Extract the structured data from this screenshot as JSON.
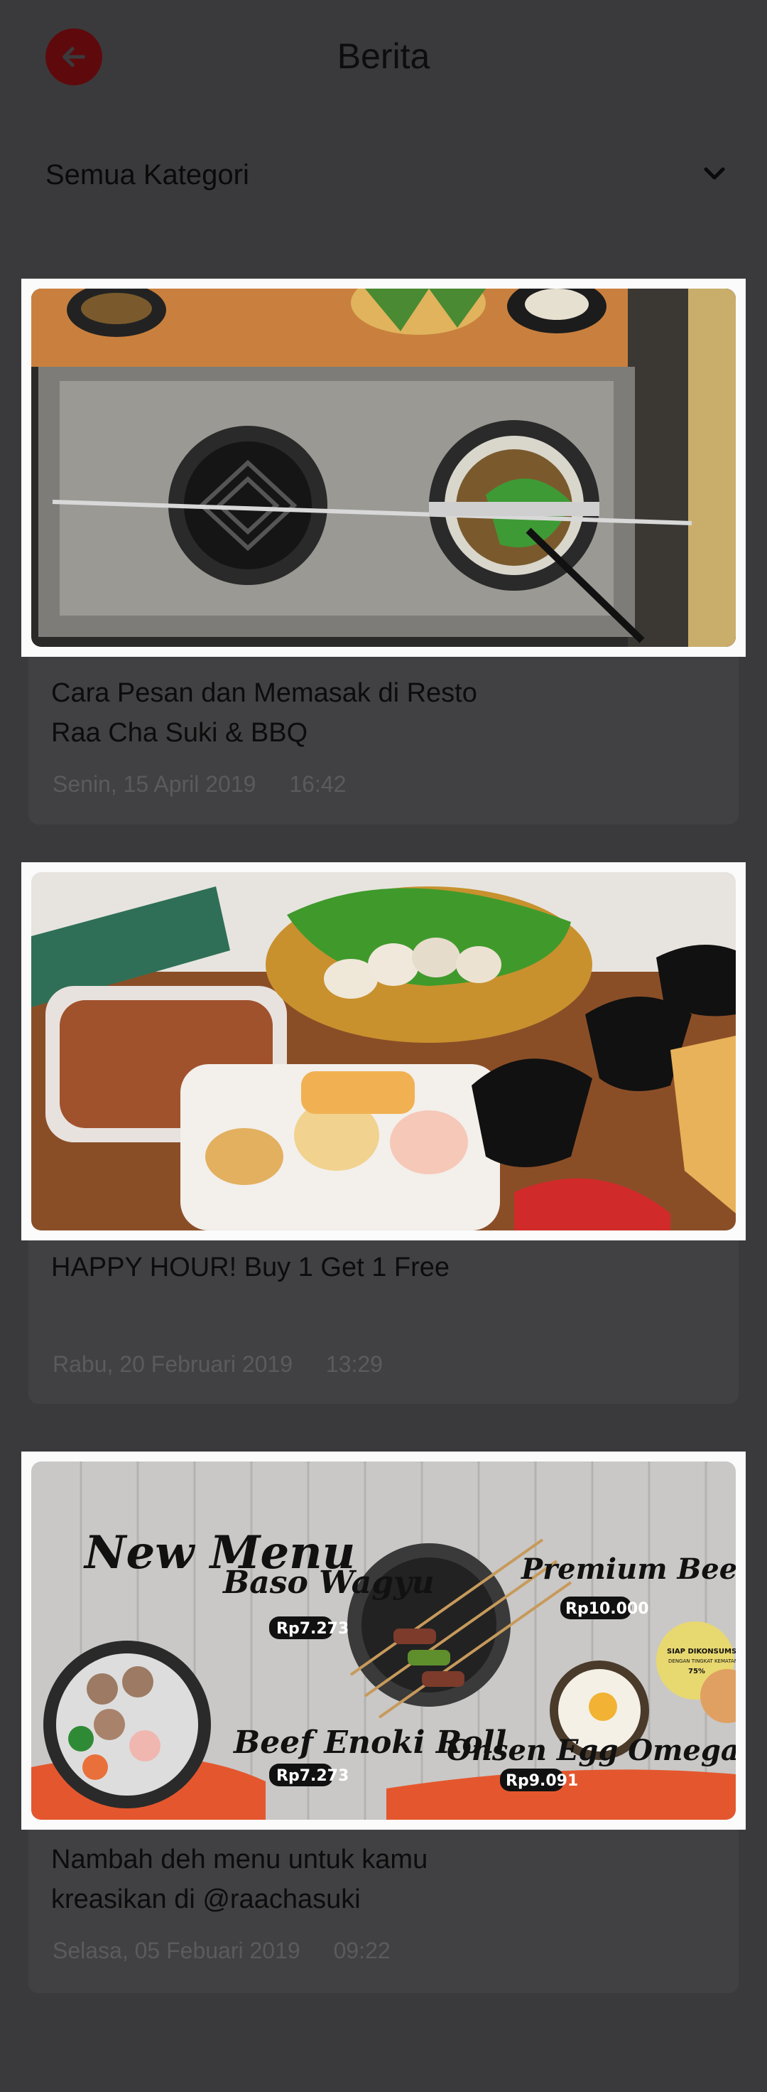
{
  "header": {
    "title": "Berita",
    "back_icon": "arrow-left-icon",
    "accent": "#5e0a0d"
  },
  "filter": {
    "label": "Semua Kategori",
    "icon": "chevron-down-icon"
  },
  "news": [
    {
      "title": "Cara Pesan dan Memasak di Resto Raa Cha Suki & BBQ",
      "date": "Senin, 15 April 2019",
      "time": "16:42"
    },
    {
      "title": "HAPPY HOUR! Buy 1 Get 1 Free",
      "date": "Rabu, 20 Februari 2019",
      "time": "13:29"
    },
    {
      "title": "Nambah deh menu untuk kamu kreasikan di @raachasuki",
      "date": "Selasa, 05 Febuari 2019",
      "time": "09:22",
      "poster": {
        "new_menu": "New Menu",
        "item1_name": "Baso Wagyu",
        "item1_price": "Rp7.273",
        "item2_name": "Beef Enoki Roll",
        "item2_price": "Rp7.273",
        "item3_name": "Premium Beef Satay",
        "item3_price": "Rp10.000",
        "item4_name": "Onsen Egg Omega",
        "item4_price": "Rp9.091",
        "badge_line1": "SIAP DIKONSUMSI",
        "badge_line2": "DENGAN TINGKAT KEMATANGAN",
        "badge_line3": "75%"
      }
    }
  ]
}
